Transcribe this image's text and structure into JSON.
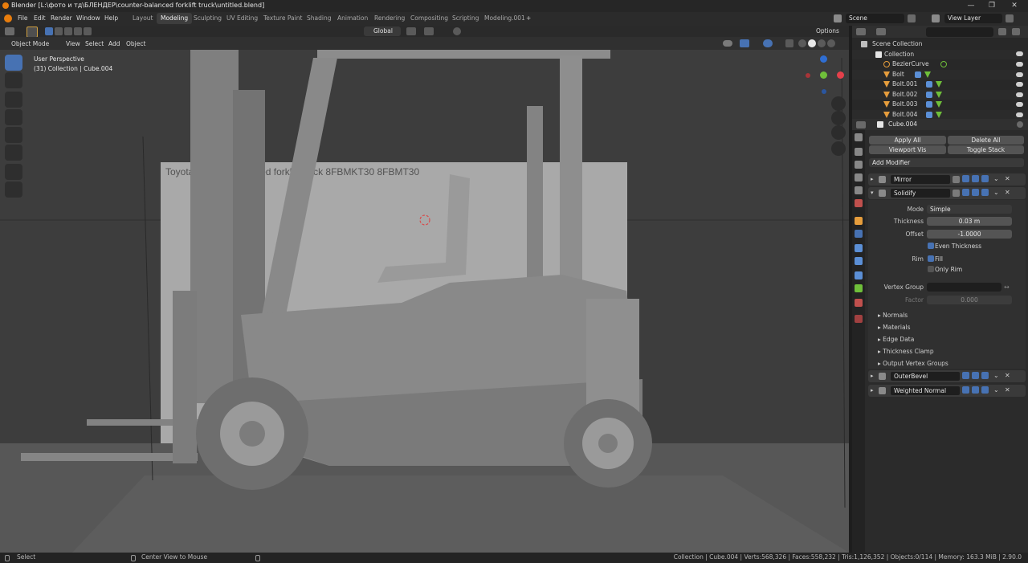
{
  "window": {
    "title": "Blender [L:\\фото и тд\\БЛЕНДЕР\\counter-balanced forklift truck\\untitled.blend]",
    "minimize": "—",
    "maximize": "❐",
    "close": "✕"
  },
  "menu": [
    "File",
    "Edit",
    "Render",
    "Window",
    "Help"
  ],
  "workspaces": [
    {
      "label": "Layout",
      "active": false
    },
    {
      "label": "Modeling",
      "active": true
    },
    {
      "label": "Sculpting",
      "active": false
    },
    {
      "label": "UV Editing",
      "active": false
    },
    {
      "label": "Texture Paint",
      "active": false
    },
    {
      "label": "Shading",
      "active": false
    },
    {
      "label": "Animation",
      "active": false
    },
    {
      "label": "Rendering",
      "active": false
    },
    {
      "label": "Compositing",
      "active": false
    },
    {
      "label": "Scripting",
      "active": false
    },
    {
      "label": "Modeling.001",
      "active": false
    }
  ],
  "add_workspace": "+",
  "scene": {
    "label": "Scene",
    "view_layer": "View Layer"
  },
  "viewport": {
    "mode": "Object Mode",
    "menus": [
      "View",
      "Select",
      "Add",
      "Object"
    ],
    "orientation": "Global",
    "options": "Options",
    "perspective": "User Perspective",
    "context": "(31) Collection | Cube.004"
  },
  "reference_text": "Toyota  counter-balanced forklift truck 8FBMKT30 8FBMT30",
  "outliner": {
    "search_placeholder": "",
    "rows": [
      {
        "name": "Scene Collection",
        "indent": 0,
        "type": "scene"
      },
      {
        "name": "Collection",
        "indent": 1,
        "type": "collection"
      },
      {
        "name": "BezierCurve",
        "indent": 2,
        "type": "curve"
      },
      {
        "name": "Bolt",
        "indent": 2,
        "type": "mesh"
      },
      {
        "name": "Bolt.001",
        "indent": 2,
        "type": "mesh"
      },
      {
        "name": "Bolt.002",
        "indent": 2,
        "type": "mesh"
      },
      {
        "name": "Bolt.003",
        "indent": 2,
        "type": "mesh"
      },
      {
        "name": "Bolt.004",
        "indent": 2,
        "type": "mesh"
      }
    ]
  },
  "properties": {
    "object_name": "Cube.004",
    "apply_all": "Apply All",
    "delete_all": "Delete All",
    "viewport_vis": "Viewport Vis",
    "toggle_stack": "Toggle Stack",
    "add_modifier": "Add Modifier",
    "modifiers": [
      {
        "name": "Mirror",
        "expanded": false
      },
      {
        "name": "Solidify",
        "expanded": true
      },
      {
        "name": "OuterBevel",
        "expanded": false
      },
      {
        "name": "Weighted Normal",
        "expanded": false
      }
    ],
    "solidify": {
      "mode_label": "Mode",
      "mode_value": "Simple",
      "thickness_label": "Thickness",
      "thickness_value": "0.03 m",
      "offset_label": "Offset",
      "offset_value": "-1.0000",
      "even_thickness": "Even Thickness",
      "rim_label": "Rim",
      "fill": "Fill",
      "only_rim": "Only Rim",
      "vertex_group_label": "Vertex Group",
      "factor_label": "Factor",
      "factor_value": "0.000",
      "subpanels": [
        "Normals",
        "Materials",
        "Edge Data",
        "Thickness Clamp",
        "Output Vertex Groups"
      ]
    }
  },
  "status": {
    "select": "Select",
    "center": "Center View to Mouse",
    "stats": "Collection | Cube.004 | Verts:568,326 | Faces:558,232 | Tris:1,126,352 | Objects:0/114 | Memory: 163.3 MiB | 2.90.0"
  },
  "colors": {
    "accent": "#4772b3",
    "panel": "#2b2b2b",
    "viewport": "#3d3d3d",
    "floor": "#575757"
  }
}
